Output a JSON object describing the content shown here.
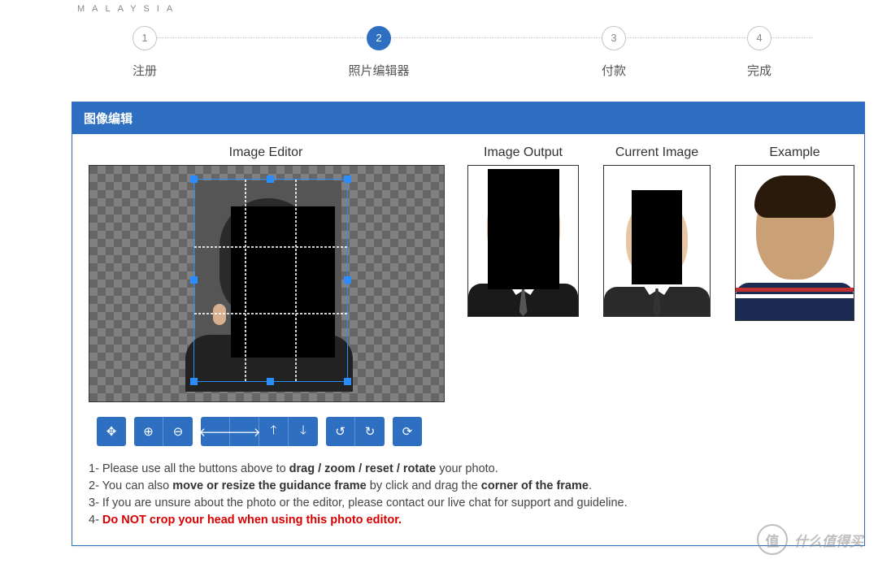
{
  "brand": "MALAYSIA",
  "steps": [
    {
      "num": "1",
      "label": "注册"
    },
    {
      "num": "2",
      "label": "照片编辑器"
    },
    {
      "num": "3",
      "label": "付款"
    },
    {
      "num": "4",
      "label": "完成"
    }
  ],
  "active_step": 1,
  "panel_title": "图像编辑",
  "sections": {
    "editor": "Image Editor",
    "output": "Image Output",
    "current": "Current Image",
    "example": "Example"
  },
  "toolbar": {
    "move": "✥",
    "zoom_in": "⊕",
    "zoom_out": "⊖",
    "left": "🡐",
    "right": "🡒",
    "up": "🡑",
    "down": "🡓",
    "rotate_ccw": "↺",
    "rotate_cw": "↻",
    "reset": "⟳"
  },
  "instructions": {
    "l1a": "1- Please use all the buttons above to ",
    "l1b": "drag / zoom / reset / rotate",
    "l1c": " your photo.",
    "l2a": "2- You can also ",
    "l2b": "move or resize the guidance frame",
    "l2c": " by click and drag the ",
    "l2d": "corner of the frame",
    "l2e": ".",
    "l3": "3- If you are unsure about the photo or the editor, please contact our live chat for support and guideline.",
    "l4a": "4- ",
    "l4b": "Do NOT crop your head when using this photo editor."
  },
  "watermark": {
    "badge": "值",
    "text": "什么值得买"
  }
}
